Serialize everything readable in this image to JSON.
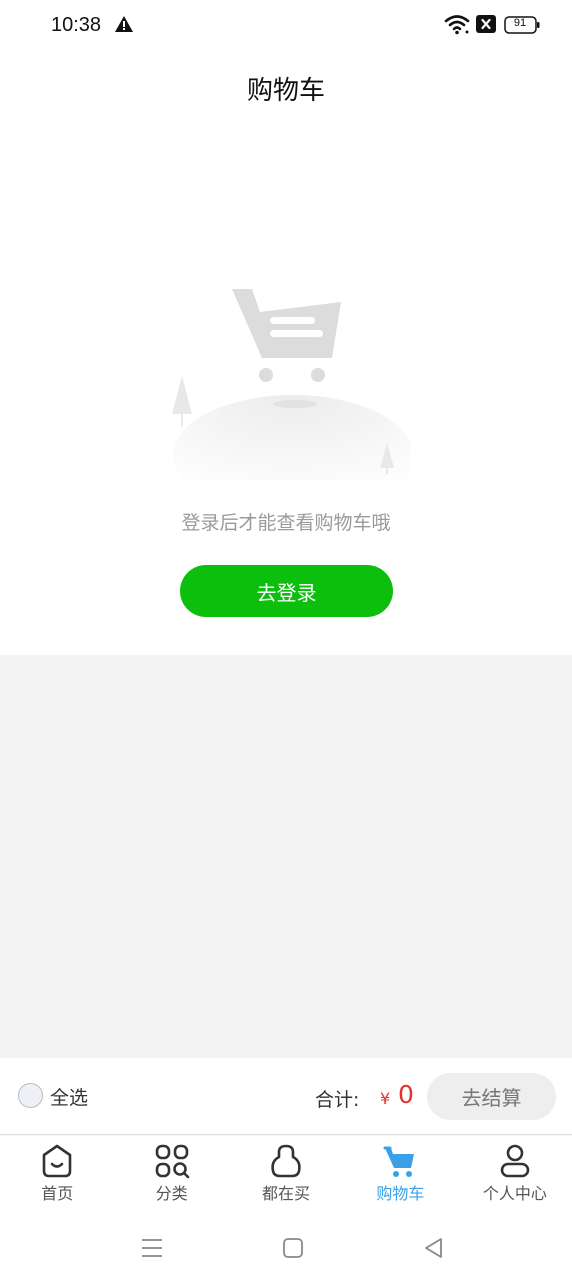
{
  "status_bar": {
    "time": "10:38",
    "battery": "91",
    "icons": [
      "warning-icon",
      "wifi-icon",
      "no-sim-icon",
      "battery-icon"
    ]
  },
  "header": {
    "title": "购物车"
  },
  "empty_state": {
    "message": "登录后才能查看购物车哦",
    "login_button": "去登录",
    "illustration": "empty-cart-illustration"
  },
  "cart_footer": {
    "select_all": "全选",
    "total_label": "合计:",
    "currency": "¥",
    "total_value": "0",
    "checkout_button": "去结算"
  },
  "tabs": [
    {
      "label": "首页",
      "icon": "home-icon",
      "active": false
    },
    {
      "label": "分类",
      "icon": "category-icon",
      "active": false
    },
    {
      "label": "都在买",
      "icon": "bag-icon",
      "active": false
    },
    {
      "label": "购物车",
      "icon": "cart-icon",
      "active": true
    },
    {
      "label": "个人中心",
      "icon": "user-icon",
      "active": false
    }
  ],
  "colors": {
    "accent_green": "#0dbf0d",
    "price_red": "#e5312f",
    "active_tab_blue": "#3aa0e8",
    "background_gray": "#f4f4f4"
  }
}
